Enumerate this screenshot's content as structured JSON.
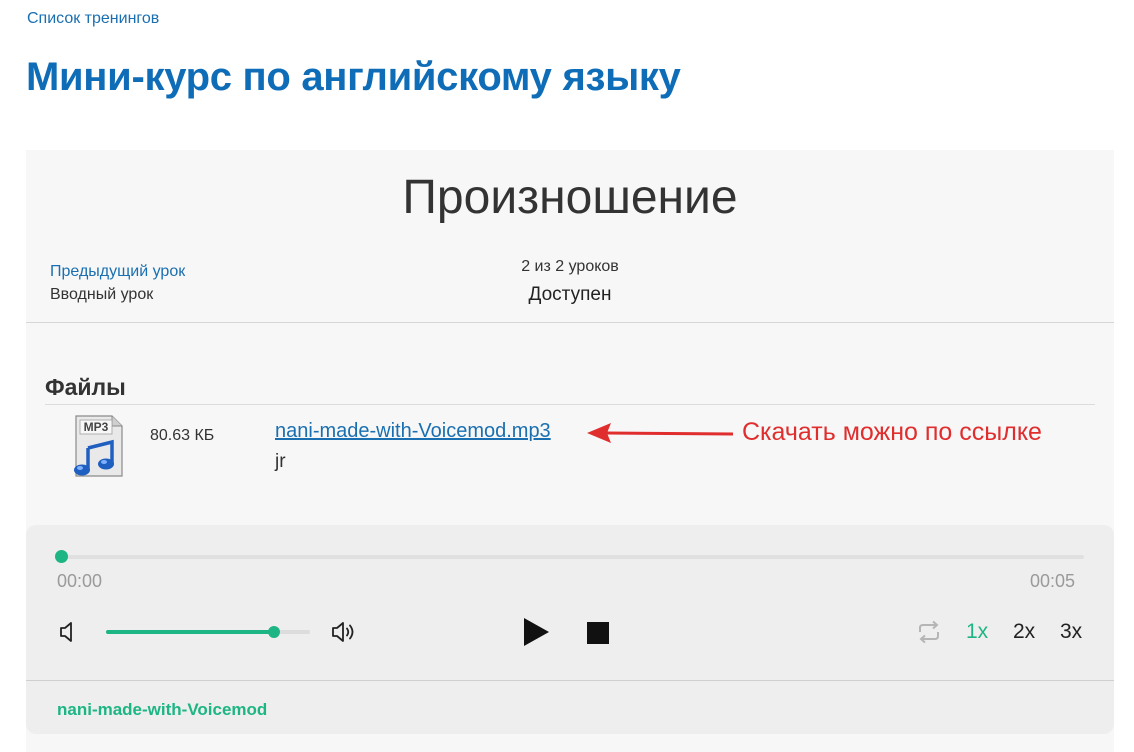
{
  "breadcrumb": {
    "label": "Список тренингов"
  },
  "page": {
    "title": "Мини-курс по английскому языку"
  },
  "lesson": {
    "title": "Произношение",
    "prev_label": "Предыдущий урок",
    "prev_name": "Вводный урок",
    "progress": "2 из 2 уроков",
    "status": "Доступен"
  },
  "files": {
    "heading": "Файлы",
    "items": [
      {
        "icon": "mp3-file-icon",
        "icon_text": "MP3",
        "size": "80.63 КБ",
        "name": "nani-made-with-Voicemod.mp3",
        "description": "jr"
      }
    ]
  },
  "annotation": {
    "text": "Скачать можно по ссылке",
    "color": "#e02d2d"
  },
  "player": {
    "time_current": "00:00",
    "time_total": "00:05",
    "playback_progress": 0,
    "volume": 0.82,
    "speeds": [
      "1x",
      "2x",
      "3x"
    ],
    "active_speed": "1x",
    "track_name": "nani-made-with-Voicemod",
    "accent_color": "#1db584"
  }
}
